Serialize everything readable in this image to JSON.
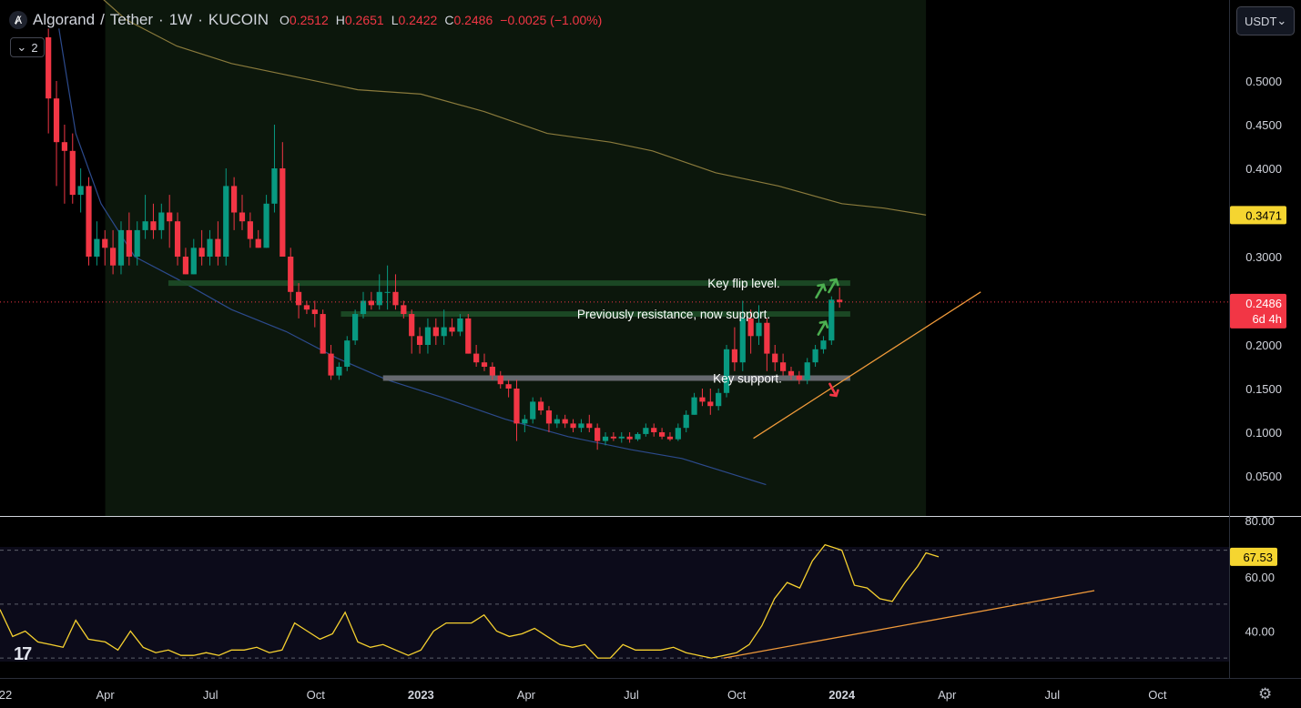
{
  "header": {
    "base": "Algorand",
    "quote": "Tether",
    "interval": "1W",
    "exchange": "KUCOIN",
    "open_label": "O",
    "open": "0.2512",
    "high_label": "H",
    "high": "0.2651",
    "low_label": "L",
    "low": "0.2422",
    "close_label": "C",
    "close": "0.2486",
    "change": "−0.0025 (−1.00%)"
  },
  "indicator_toggle": {
    "count": "2"
  },
  "currency_selector": {
    "value": "USDT"
  },
  "price_badges": {
    "ma_value": "0.3471",
    "last_price": "0.2486",
    "countdown": "6d 4h"
  },
  "rsi_badge": "67.53",
  "colors": {
    "up": "#089981",
    "down": "#f23645",
    "ma_upper": "#8a7a3c",
    "ma_lower": "#2c4a8c",
    "rsi": "#f5d02f",
    "trend": "#f09a3a",
    "zone_green": "#1c4a26",
    "zone_gray": "#6b6e75",
    "badge_yellow": "#f5d530",
    "badge_red": "#f23645"
  },
  "icons": {
    "arrow_up": "green-arrow-up-icon",
    "arrow_down": "red-arrow-down-icon",
    "gear": "settings-gear-icon"
  },
  "chart_data": [
    {
      "type": "candlestick",
      "title": "Algorand / Tether · 1W · KUCOIN",
      "y_tick_labels": [
        "0.0500",
        "0.1000",
        "0.1500",
        "0.2000",
        "0.3000",
        "0.4000",
        "0.4500",
        "0.5000"
      ],
      "ylim": [
        0.02,
        0.56
      ],
      "x_tick_labels": [
        "22",
        "Apr",
        "Jul",
        "Oct",
        "2023",
        "Apr",
        "Jul",
        "Oct",
        "2024",
        "Apr",
        "Jul",
        "Oct"
      ],
      "x_tick_times": [
        2022.0,
        2022.25,
        2022.5,
        2022.75,
        2023.0,
        2023.25,
        2023.5,
        2023.75,
        2024.0,
        2024.25,
        2024.5,
        2024.75
      ],
      "xlim": [
        2022.0,
        2024.92
      ],
      "candle_start": 2022.115,
      "candle_step": 0.01918,
      "candles": [
        [
          0.55,
          0.56,
          0.44,
          0.48
        ],
        [
          0.48,
          0.5,
          0.38,
          0.43
        ],
        [
          0.43,
          0.45,
          0.36,
          0.42
        ],
        [
          0.42,
          0.44,
          0.36,
          0.37
        ],
        [
          0.37,
          0.4,
          0.35,
          0.38
        ],
        [
          0.38,
          0.39,
          0.29,
          0.3
        ],
        [
          0.3,
          0.34,
          0.29,
          0.32
        ],
        [
          0.32,
          0.33,
          0.29,
          0.31
        ],
        [
          0.31,
          0.33,
          0.28,
          0.29
        ],
        [
          0.29,
          0.34,
          0.28,
          0.33
        ],
        [
          0.33,
          0.35,
          0.29,
          0.3
        ],
        [
          0.3,
          0.34,
          0.29,
          0.33
        ],
        [
          0.33,
          0.37,
          0.32,
          0.34
        ],
        [
          0.34,
          0.36,
          0.32,
          0.33
        ],
        [
          0.33,
          0.36,
          0.32,
          0.35
        ],
        [
          0.35,
          0.37,
          0.31,
          0.34
        ],
        [
          0.34,
          0.35,
          0.29,
          0.3
        ],
        [
          0.3,
          0.31,
          0.28,
          0.28
        ],
        [
          0.28,
          0.32,
          0.28,
          0.31
        ],
        [
          0.31,
          0.33,
          0.29,
          0.3
        ],
        [
          0.3,
          0.33,
          0.29,
          0.32
        ],
        [
          0.32,
          0.34,
          0.29,
          0.3
        ],
        [
          0.3,
          0.4,
          0.29,
          0.38
        ],
        [
          0.38,
          0.39,
          0.33,
          0.35
        ],
        [
          0.35,
          0.37,
          0.33,
          0.34
        ],
        [
          0.34,
          0.35,
          0.31,
          0.32
        ],
        [
          0.32,
          0.33,
          0.31,
          0.31
        ],
        [
          0.31,
          0.37,
          0.31,
          0.36
        ],
        [
          0.36,
          0.45,
          0.35,
          0.4
        ],
        [
          0.4,
          0.43,
          0.3,
          0.3
        ],
        [
          0.3,
          0.31,
          0.25,
          0.26
        ],
        [
          0.26,
          0.27,
          0.23,
          0.245
        ],
        [
          0.245,
          0.25,
          0.235,
          0.24
        ],
        [
          0.24,
          0.25,
          0.22,
          0.235
        ],
        [
          0.235,
          0.24,
          0.19,
          0.19
        ],
        [
          0.19,
          0.2,
          0.16,
          0.165
        ],
        [
          0.165,
          0.18,
          0.16,
          0.175
        ],
        [
          0.175,
          0.21,
          0.17,
          0.205
        ],
        [
          0.205,
          0.24,
          0.2,
          0.235
        ],
        [
          0.235,
          0.26,
          0.23,
          0.25
        ],
        [
          0.25,
          0.26,
          0.24,
          0.245
        ],
        [
          0.245,
          0.28,
          0.24,
          0.26
        ],
        [
          0.26,
          0.29,
          0.24,
          0.26
        ],
        [
          0.26,
          0.28,
          0.24,
          0.245
        ],
        [
          0.245,
          0.25,
          0.23,
          0.235
        ],
        [
          0.235,
          0.24,
          0.19,
          0.21
        ],
        [
          0.21,
          0.22,
          0.19,
          0.2
        ],
        [
          0.2,
          0.23,
          0.19,
          0.22
        ],
        [
          0.22,
          0.23,
          0.2,
          0.21
        ],
        [
          0.21,
          0.24,
          0.2,
          0.22
        ],
        [
          0.22,
          0.23,
          0.21,
          0.215
        ],
        [
          0.215,
          0.235,
          0.21,
          0.23
        ],
        [
          0.23,
          0.235,
          0.19,
          0.19
        ],
        [
          0.19,
          0.2,
          0.175,
          0.18
        ],
        [
          0.18,
          0.19,
          0.17,
          0.175
        ],
        [
          0.175,
          0.18,
          0.16,
          0.165
        ],
        [
          0.165,
          0.17,
          0.15,
          0.155
        ],
        [
          0.155,
          0.16,
          0.14,
          0.15
        ],
        [
          0.15,
          0.16,
          0.09,
          0.11
        ],
        [
          0.11,
          0.12,
          0.1,
          0.115
        ],
        [
          0.115,
          0.14,
          0.11,
          0.135
        ],
        [
          0.135,
          0.14,
          0.12,
          0.125
        ],
        [
          0.125,
          0.13,
          0.1,
          0.11
        ],
        [
          0.11,
          0.12,
          0.105,
          0.115
        ],
        [
          0.115,
          0.12,
          0.105,
          0.11
        ],
        [
          0.11,
          0.115,
          0.1,
          0.105
        ],
        [
          0.105,
          0.115,
          0.1,
          0.11
        ],
        [
          0.11,
          0.12,
          0.1,
          0.105
        ],
        [
          0.105,
          0.11,
          0.08,
          0.09
        ],
        [
          0.09,
          0.1,
          0.085,
          0.095
        ],
        [
          0.095,
          0.1,
          0.09,
          0.093
        ],
        [
          0.093,
          0.1,
          0.088,
          0.095
        ],
        [
          0.095,
          0.1,
          0.088,
          0.092
        ],
        [
          0.092,
          0.1,
          0.09,
          0.098
        ],
        [
          0.098,
          0.11,
          0.095,
          0.105
        ],
        [
          0.105,
          0.11,
          0.095,
          0.1
        ],
        [
          0.1,
          0.105,
          0.092,
          0.095
        ],
        [
          0.095,
          0.1,
          0.09,
          0.092
        ],
        [
          0.092,
          0.11,
          0.09,
          0.105
        ],
        [
          0.105,
          0.125,
          0.1,
          0.12
        ],
        [
          0.12,
          0.145,
          0.12,
          0.14
        ],
        [
          0.14,
          0.15,
          0.13,
          0.135
        ],
        [
          0.135,
          0.15,
          0.12,
          0.13
        ],
        [
          0.13,
          0.15,
          0.125,
          0.145
        ],
        [
          0.145,
          0.2,
          0.14,
          0.195
        ],
        [
          0.195,
          0.22,
          0.17,
          0.18
        ],
        [
          0.18,
          0.25,
          0.17,
          0.23
        ],
        [
          0.23,
          0.24,
          0.19,
          0.21
        ],
        [
          0.21,
          0.245,
          0.2,
          0.225
        ],
        [
          0.225,
          0.23,
          0.17,
          0.19
        ],
        [
          0.19,
          0.2,
          0.17,
          0.18
        ],
        [
          0.18,
          0.19,
          0.165,
          0.17
        ],
        [
          0.17,
          0.175,
          0.16,
          0.165
        ],
        [
          0.165,
          0.17,
          0.155,
          0.16
        ],
        [
          0.16,
          0.185,
          0.155,
          0.18
        ],
        [
          0.18,
          0.2,
          0.175,
          0.195
        ],
        [
          0.195,
          0.21,
          0.19,
          0.205
        ],
        [
          0.205,
          0.255,
          0.2,
          0.2512
        ],
        [
          0.2512,
          0.2651,
          0.2422,
          0.2486
        ]
      ],
      "moving_averages": [
        {
          "name": "",
          "points": [
            [
              2022.23,
              0.6
            ],
            [
              2022.3,
              0.57
            ],
            [
              2022.42,
              0.54
            ],
            [
              2022.55,
              0.52
            ],
            [
              2022.7,
              0.505
            ],
            [
              2022.85,
              0.49
            ],
            [
              2023.0,
              0.485
            ],
            [
              2023.15,
              0.465
            ],
            [
              2023.3,
              0.44
            ],
            [
              2023.45,
              0.43
            ],
            [
              2023.55,
              0.42
            ],
            [
              2023.7,
              0.395
            ],
            [
              2023.85,
              0.38
            ],
            [
              2024.0,
              0.36
            ],
            [
              2024.1,
              0.355
            ],
            [
              2024.2,
              0.3471
            ]
          ]
        },
        {
          "name": "",
          "points": [
            [
              2022.14,
              0.56
            ],
            [
              2022.18,
              0.44
            ],
            [
              2022.24,
              0.36
            ],
            [
              2022.32,
              0.3
            ],
            [
              2022.42,
              0.275
            ],
            [
              2022.55,
              0.24
            ],
            [
              2022.68,
              0.215
            ],
            [
              2022.8,
              0.185
            ],
            [
              2022.92,
              0.16
            ],
            [
              2023.05,
              0.14
            ],
            [
              2023.2,
              0.115
            ],
            [
              2023.35,
              0.095
            ],
            [
              2023.5,
              0.08
            ],
            [
              2023.62,
              0.07
            ],
            [
              2023.72,
              0.055
            ],
            [
              2023.82,
              0.04
            ]
          ]
        }
      ],
      "horizontal_zones": [
        {
          "label": "Key flip level.",
          "price": 0.27,
          "x_start": 2022.4,
          "x_end": 2024.02,
          "color": "green"
        },
        {
          "label": "Previously resistance, now support.",
          "price": 0.235,
          "x_start": 2022.81,
          "x_end": 2024.02,
          "color": "green"
        },
        {
          "label": "Key support.",
          "price": 0.162,
          "x_start": 2022.91,
          "x_end": 2024.02,
          "color": "gray"
        }
      ],
      "trendline": [
        [
          2023.79,
          0.093
        ],
        [
          2024.33,
          0.26
        ]
      ],
      "shaded_region": [
        2022.25,
        2024.2
      ],
      "markers": [
        {
          "icon": "arrow_up",
          "x": 2023.95,
          "price": 0.262
        },
        {
          "icon": "arrow_up",
          "x": 2023.98,
          "price": 0.268
        },
        {
          "icon": "arrow_up",
          "x": 2023.955,
          "price": 0.22
        },
        {
          "icon": "arrow_down",
          "x": 2023.98,
          "price": 0.148
        }
      ]
    },
    {
      "type": "line",
      "y_tick_labels": [
        "40.00",
        "60.00",
        "80.00"
      ],
      "ylim": [
        26,
        82
      ],
      "reference_lines": [
        70,
        50,
        30
      ],
      "series": [
        {
          "name": "",
          "points": [
            [
              2022.0,
              48
            ],
            [
              2022.03,
              38
            ],
            [
              2022.06,
              40
            ],
            [
              2022.09,
              36
            ],
            [
              2022.12,
              35
            ],
            [
              2022.15,
              34
            ],
            [
              2022.18,
              44
            ],
            [
              2022.21,
              37
            ],
            [
              2022.25,
              36
            ],
            [
              2022.28,
              33
            ],
            [
              2022.31,
              40
            ],
            [
              2022.34,
              34
            ],
            [
              2022.37,
              32
            ],
            [
              2022.4,
              33
            ],
            [
              2022.43,
              31
            ],
            [
              2022.46,
              31
            ],
            [
              2022.49,
              32
            ],
            [
              2022.52,
              31
            ],
            [
              2022.55,
              33
            ],
            [
              2022.58,
              33
            ],
            [
              2022.61,
              34
            ],
            [
              2022.64,
              32
            ],
            [
              2022.67,
              33
            ],
            [
              2022.7,
              43
            ],
            [
              2022.73,
              40
            ],
            [
              2022.76,
              37
            ],
            [
              2022.79,
              39
            ],
            [
              2022.82,
              47
            ],
            [
              2022.85,
              36
            ],
            [
              2022.88,
              34
            ],
            [
              2022.91,
              35
            ],
            [
              2022.94,
              33
            ],
            [
              2022.97,
              31
            ],
            [
              2023.0,
              33
            ],
            [
              2023.03,
              40
            ],
            [
              2023.06,
              43
            ],
            [
              2023.09,
              43
            ],
            [
              2023.12,
              43
            ],
            [
              2023.15,
              46
            ],
            [
              2023.18,
              40
            ],
            [
              2023.21,
              38
            ],
            [
              2023.24,
              39
            ],
            [
              2023.27,
              41
            ],
            [
              2023.3,
              38
            ],
            [
              2023.33,
              35
            ],
            [
              2023.36,
              34
            ],
            [
              2023.39,
              35
            ],
            [
              2023.42,
              30
            ],
            [
              2023.45,
              30
            ],
            [
              2023.48,
              35
            ],
            [
              2023.51,
              33
            ],
            [
              2023.54,
              33
            ],
            [
              2023.57,
              33
            ],
            [
              2023.6,
              34
            ],
            [
              2023.63,
              32
            ],
            [
              2023.66,
              31
            ],
            [
              2023.69,
              30
            ],
            [
              2023.72,
              31
            ],
            [
              2023.75,
              32
            ],
            [
              2023.78,
              35
            ],
            [
              2023.81,
              42
            ],
            [
              2023.84,
              52
            ],
            [
              2023.87,
              58
            ],
            [
              2023.9,
              56
            ],
            [
              2023.93,
              66
            ],
            [
              2023.96,
              72
            ],
            [
              2024.0,
              70
            ],
            [
              2024.03,
              57
            ],
            [
              2024.06,
              56
            ],
            [
              2024.09,
              52
            ],
            [
              2024.12,
              51
            ],
            [
              2024.15,
              58
            ],
            [
              2024.18,
              64
            ],
            [
              2024.2,
              69
            ],
            [
              2024.23,
              67.53
            ]
          ]
        }
      ],
      "trendline": [
        [
          2023.72,
          30
        ],
        [
          2024.6,
          55
        ]
      ]
    }
  ]
}
